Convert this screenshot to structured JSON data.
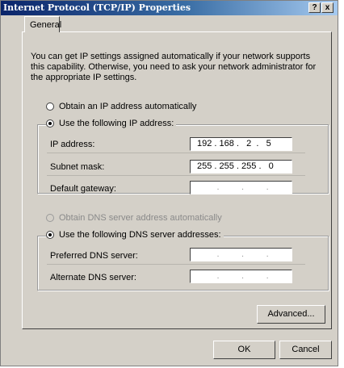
{
  "window": {
    "title": "Internet Protocol (TCP/IP) Properties",
    "help": "?",
    "close": "x"
  },
  "tabs": [
    {
      "label": "General"
    }
  ],
  "description": "You can get IP settings assigned automatically if your network supports this capability. Otherwise, you need to ask your network administrator for the appropriate IP settings.",
  "ip": {
    "auto_label": "Obtain an IP address automatically",
    "manual_label": "Use the following IP address:",
    "address_label": "IP address:",
    "address_value": "192 . 168 .   2  .   5",
    "subnet_label": "Subnet mask:",
    "subnet_value": "255 . 255 . 255 .   0",
    "gateway_label": "Default gateway:",
    "gateway_value": "        .         .         ."
  },
  "dns": {
    "auto_label": "Obtain DNS server address automatically",
    "manual_label": "Use the following DNS server addresses:",
    "preferred_label": "Preferred DNS server:",
    "preferred_value": "        .         .         .",
    "alternate_label": "Alternate DNS server:",
    "alternate_value": "        .         .         ."
  },
  "buttons": {
    "advanced": "Advanced...",
    "ok": "OK",
    "cancel": "Cancel"
  }
}
